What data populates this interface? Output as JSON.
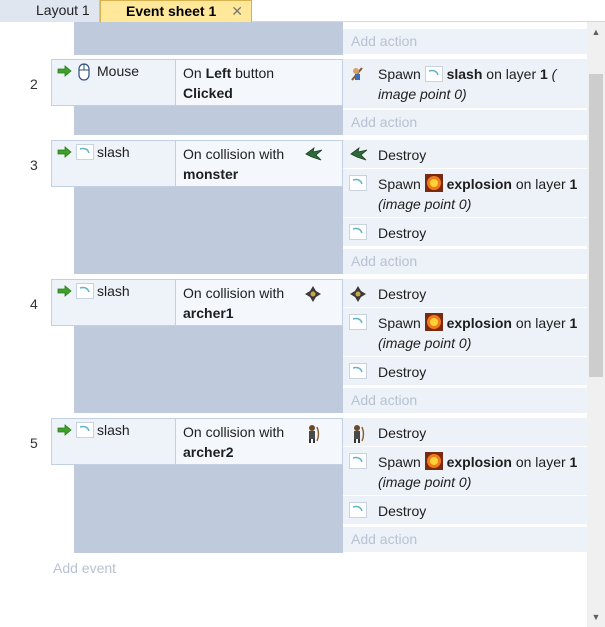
{
  "tabs": [
    {
      "label": "Layout 1",
      "active": false
    },
    {
      "label": "Event sheet 1",
      "active": true,
      "close_glyph": "✕"
    }
  ],
  "add_action_label": "Add action",
  "add_event_label": "Add event",
  "events": [
    {
      "number": "2",
      "condition": {
        "object": "Mouse",
        "icon": "mouse-icon",
        "pre": "On ",
        "bold1": "Left",
        "mid": " button ",
        "bold2": "Clicked"
      },
      "actions": [
        {
          "icon": "player-sprite-icon",
          "verb": "Spawn",
          "object": "slash",
          "object_icon": "slash-sprite-icon",
          "suffix": " on layer ",
          "layer": "1",
          "tail": " (",
          "line2": "image point 0)"
        }
      ]
    },
    {
      "number": "3",
      "condition": {
        "object": "slash",
        "icon": "slash-sprite-icon",
        "pre": "On collision with",
        "target": "monster",
        "target_icon": "monster-sprite-icon"
      },
      "actions": [
        {
          "icon": "monster-sprite-icon",
          "verb": "Destroy"
        },
        {
          "icon": "slash-sprite-icon",
          "verb": "Spawn",
          "object": "explosion",
          "object_icon": "explosion-sprite-icon",
          "suffix": " on layer ",
          "layer": "1",
          "line2": "(image point 0)"
        },
        {
          "icon": "slash-sprite-icon",
          "verb": "Destroy"
        }
      ]
    },
    {
      "number": "4",
      "condition": {
        "object": "slash",
        "icon": "slash-sprite-icon",
        "pre": "On collision with",
        "target": "archer1",
        "target_icon": "archer1-sprite-icon"
      },
      "actions": [
        {
          "icon": "archer1-sprite-icon",
          "verb": "Destroy"
        },
        {
          "icon": "slash-sprite-icon",
          "verb": "Spawn",
          "object": "explosion",
          "object_icon": "explosion-sprite-icon",
          "suffix": " on layer ",
          "layer": "1",
          "line2": "(image point 0)"
        },
        {
          "icon": "slash-sprite-icon",
          "verb": "Destroy"
        }
      ]
    },
    {
      "number": "5",
      "condition": {
        "object": "slash",
        "icon": "slash-sprite-icon",
        "pre": "On collision with",
        "target": "archer2",
        "target_icon": "archer2-sprite-icon"
      },
      "actions": [
        {
          "icon": "archer2-sprite-icon",
          "verb": "Destroy"
        },
        {
          "icon": "slash-sprite-icon",
          "verb": "Spawn",
          "object": "explosion",
          "object_icon": "explosion-sprite-icon",
          "suffix": " on layer ",
          "layer": "1",
          "line2": "(image point 0)"
        },
        {
          "icon": "slash-sprite-icon",
          "verb": "Destroy"
        }
      ]
    }
  ],
  "colors": {
    "active_tab": "#ffe89a",
    "condition_bg": "#bfcbdd",
    "action_bg": "#edf1f8",
    "add_text": "#b8c2d2"
  }
}
